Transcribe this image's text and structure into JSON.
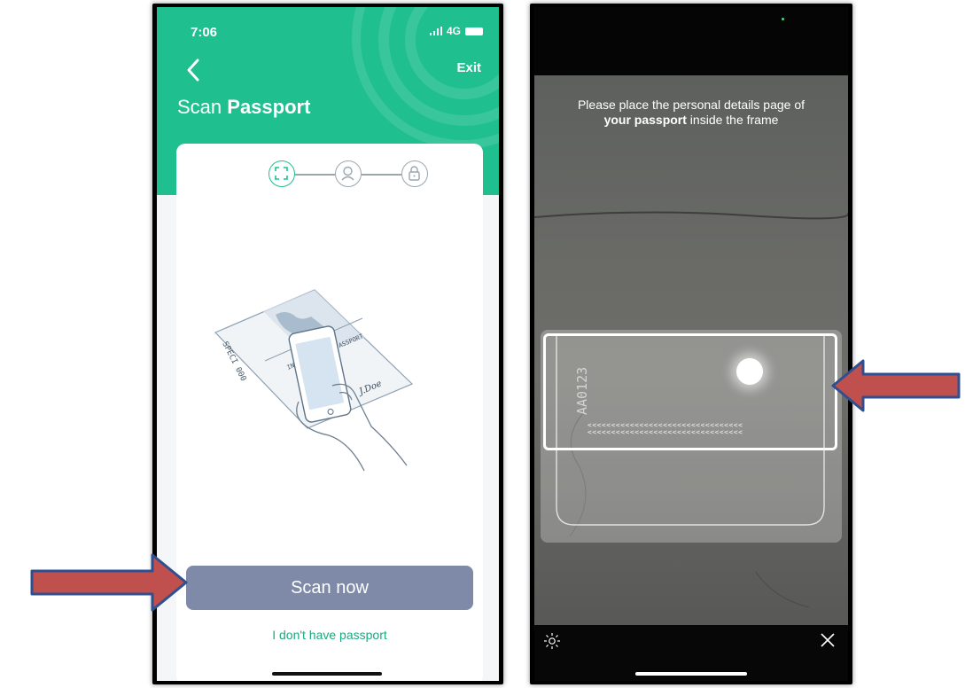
{
  "left_phone": {
    "status_bar": {
      "time": "7:06",
      "network": "4G"
    },
    "header": {
      "exit_label": "Exit",
      "title_prefix": "Scan ",
      "title_bold": "Passport"
    },
    "steps": [
      {
        "icon": "scan-frame-icon",
        "active": true
      },
      {
        "icon": "face-icon",
        "active": false
      },
      {
        "icon": "lock-icon",
        "active": false
      }
    ],
    "illustration": {
      "icon": "passport-scan-illustration",
      "passport_header": "INTERNATIONAL PASSPORT",
      "signature": "J.Doe"
    },
    "scan_button_label": "Scan now",
    "no_passport_link": "I don't have passport",
    "colors": {
      "brand_green": "#1fbf8f",
      "button": "#7e8aa7"
    }
  },
  "right_phone": {
    "instruction_line1": "Please place the personal details page of",
    "instruction_bold": "your passport",
    "instruction_rest": " inside the frame",
    "mrz_line": "<<<<<<<<<<<<<<<<<<<<<<<<<<<<<<<<<",
    "toolbar": {
      "torch_icon": "sun-icon",
      "close_icon": "close-icon"
    }
  },
  "annotations": {
    "arrow_color": "#c0504d",
    "arrow_outline": "#2f4f8f"
  }
}
